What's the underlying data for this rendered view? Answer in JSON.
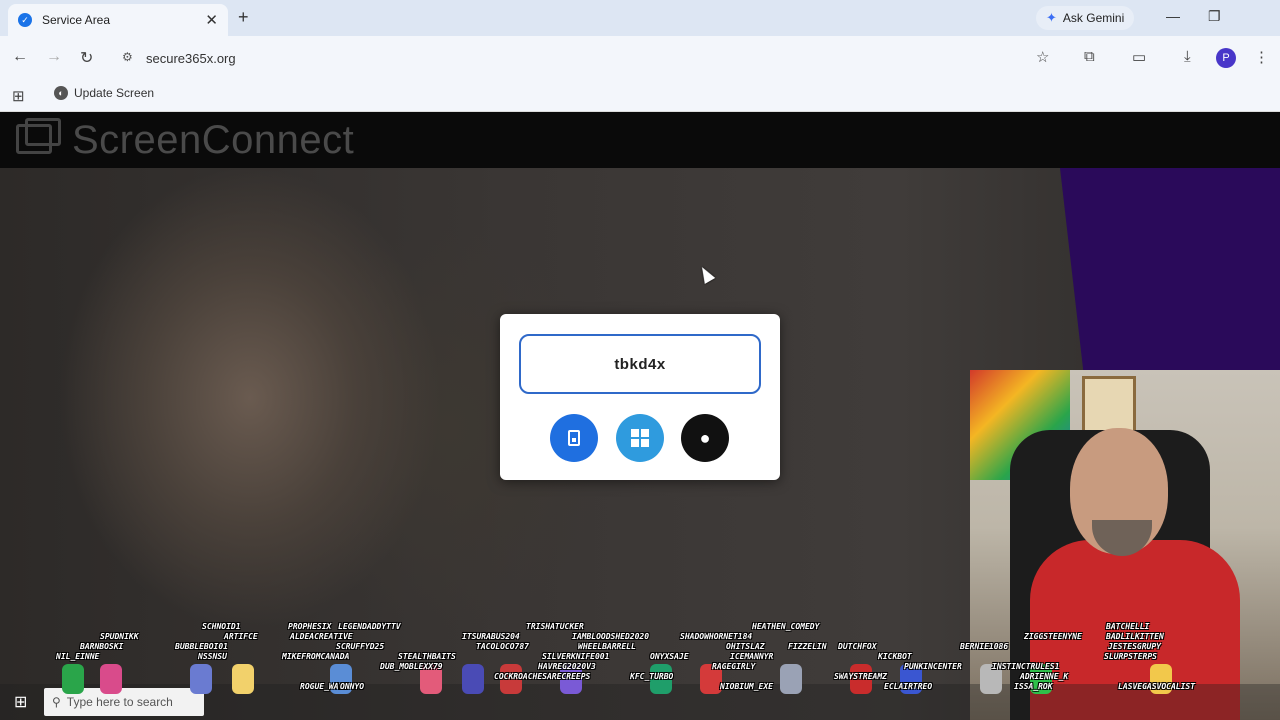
{
  "browser": {
    "tab_title": "Service Area",
    "url": "secure365x.org",
    "ask_gemini": "Ask Gemini",
    "profile_initial": "P",
    "bookmark_label": "Update Screen"
  },
  "page": {
    "logo_text": "ScreenConnect",
    "session_code": "tbkd4x",
    "buttons": [
      "mobile-download",
      "windows-download",
      "mac-download"
    ]
  },
  "taskbar": {
    "search_placeholder": "Type here to search"
  },
  "stream_overlay": {
    "names": [
      {
        "text": "SPUDNIKK"
      },
      {
        "text": "BARNBOSKI"
      },
      {
        "text": "NIL_EINNE"
      },
      {
        "text": "SCHNOID1"
      },
      {
        "text": "ARTIFCE"
      },
      {
        "text": "BUBBLEBOI01"
      },
      {
        "text": "NSSNSU"
      },
      {
        "text": "PROPHESIX"
      },
      {
        "text": "ALDEACREATIVE"
      },
      {
        "text": "SCRUFFYD25"
      },
      {
        "text": "MIKEFROMCANADA"
      },
      {
        "text": "LEGENDADDYTTV"
      },
      {
        "text": "STEALTHBAITS"
      },
      {
        "text": "DUB_MOBLEXX79"
      },
      {
        "text": "ITSURABUS204"
      },
      {
        "text": "TACOLOCO787"
      },
      {
        "text": "TRISHATUCKER"
      },
      {
        "text": "IAMBLOODSHED2020"
      },
      {
        "text": "WHEELBARRELL"
      },
      {
        "text": "SILVERKNIFE001"
      },
      {
        "text": "HAVREG2020V3"
      },
      {
        "text": "COCKROACHESARECREEPS"
      },
      {
        "text": "KFC_TURBO"
      },
      {
        "text": "ONYXSAJE"
      },
      {
        "text": "SHADOWHORNET184"
      },
      {
        "text": "OHITSLAZ"
      },
      {
        "text": "ICEMANNYR"
      },
      {
        "text": "RAGEGIRLY"
      },
      {
        "text": "NIOBIUM_EXE"
      },
      {
        "text": "HEATHEN_COMEDY"
      },
      {
        "text": "FIZZELIN"
      },
      {
        "text": "DUTCHFOX"
      },
      {
        "text": "KICKBOT"
      },
      {
        "text": "SWAYSTREAMZ"
      },
      {
        "text": "ECLAIRTREO"
      },
      {
        "text": "PUNKINCENTER"
      },
      {
        "text": "BERNIE1086"
      },
      {
        "text": "ZIGGSTEENYNE"
      },
      {
        "text": "INSTINCTRULES1"
      },
      {
        "text": "ADRIENNE_K"
      },
      {
        "text": "ISSA_ROK"
      },
      {
        "text": "BATCHELLI"
      },
      {
        "text": "BADLILKITTEN"
      },
      {
        "text": "JESTESGRUPY"
      },
      {
        "text": "SLURPSTERPS"
      },
      {
        "text": "LASVEGASVOCALIST"
      },
      {
        "text": "ROGUE_WAVE"
      },
      {
        "text": "ONNYO"
      }
    ]
  }
}
